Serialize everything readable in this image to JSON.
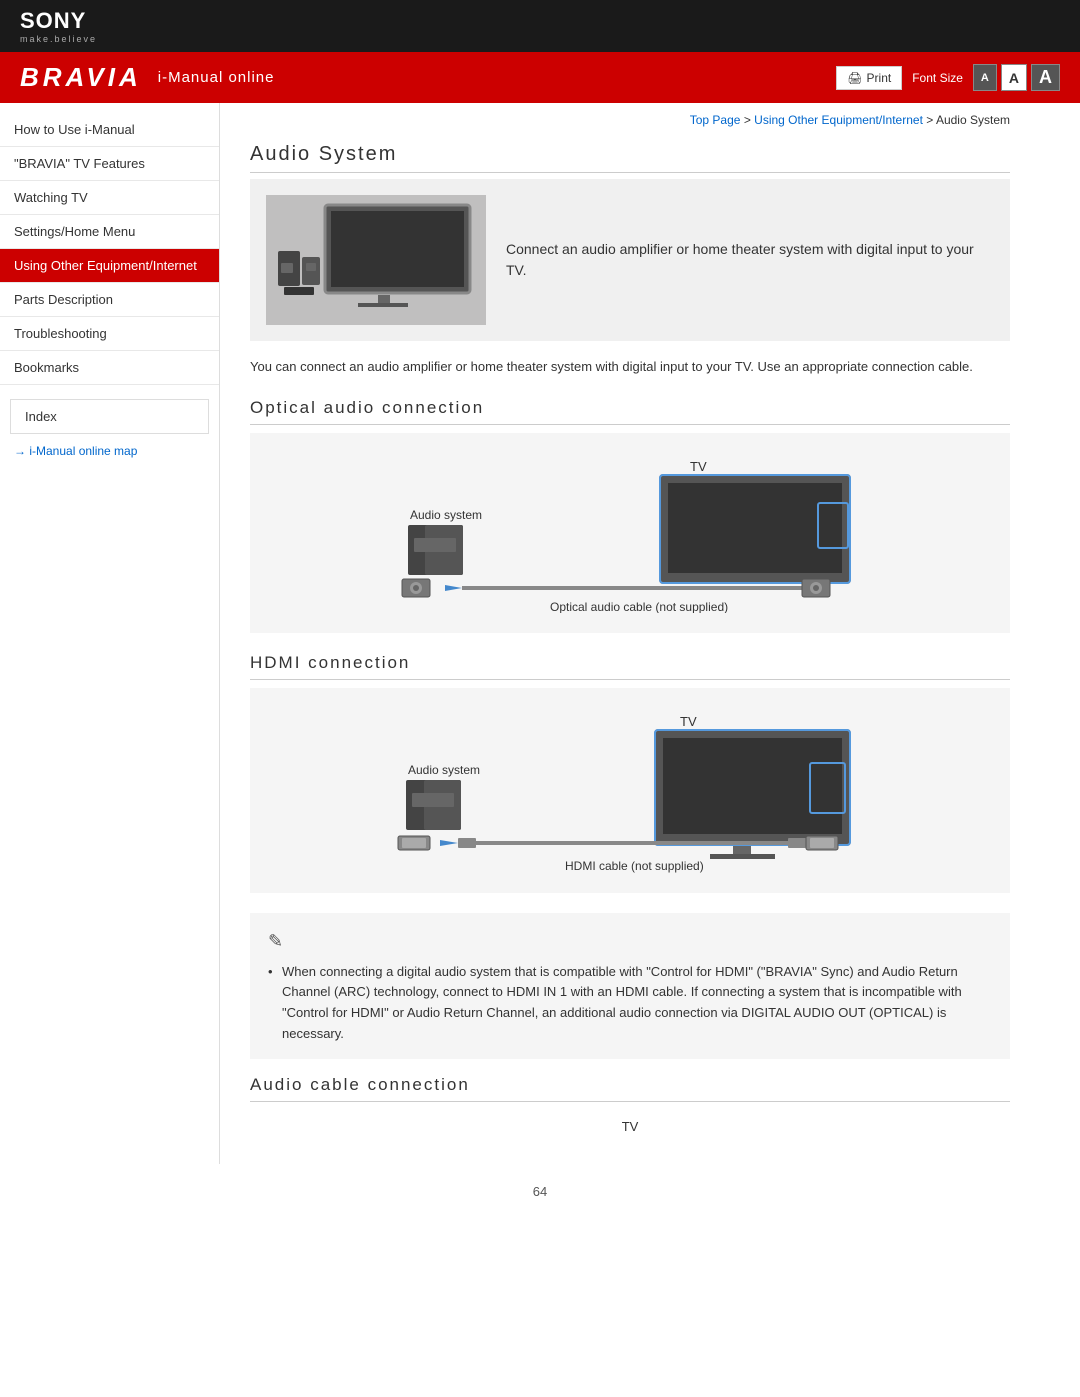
{
  "header": {
    "sony_logo": "SONY",
    "sony_tagline": "make.believe",
    "bravia_logo": "BRAVIA",
    "imanual_label": "i-Manual online",
    "print_label": "Print",
    "font_size_label": "Font Size",
    "font_sizes": [
      "A",
      "A",
      "A"
    ]
  },
  "breadcrumb": {
    "top_page": "Top Page",
    "separator1": " > ",
    "section": "Using Other Equipment/Internet",
    "separator2": " > ",
    "current": "Audio System"
  },
  "sidebar": {
    "items": [
      {
        "id": "how-to-use",
        "label": "How to Use i-Manual",
        "active": false
      },
      {
        "id": "bravia-features",
        "label": "\"BRAVIA\" TV Features",
        "active": false
      },
      {
        "id": "watching-tv",
        "label": "Watching TV",
        "active": false
      },
      {
        "id": "settings-home",
        "label": "Settings/Home Menu",
        "active": false
      },
      {
        "id": "using-other",
        "label": "Using Other Equipment/Internet",
        "active": true
      },
      {
        "id": "parts-description",
        "label": "Parts Description",
        "active": false
      },
      {
        "id": "troubleshooting",
        "label": "Troubleshooting",
        "active": false
      },
      {
        "id": "bookmarks",
        "label": "Bookmarks",
        "active": false
      }
    ],
    "index_label": "Index",
    "map_link": "→ i-Manual online map"
  },
  "content": {
    "page_title": "Audio System",
    "intro_text": "Connect an audio amplifier or home theater system with digital input to your TV.",
    "intro_desc": "You can connect an audio amplifier or home theater system with digital input to your TV. Use an appropriate connection cable.",
    "optical_title": "Optical audio connection",
    "optical_label_tv": "TV",
    "optical_label_audio": "Audio system",
    "optical_cable_label": "Optical audio cable (not supplied)",
    "hdmi_title": "HDMI connection",
    "hdmi_label_tv": "TV",
    "hdmi_label_audio": "Audio system",
    "hdmi_cable_label": "HDMI cable (not supplied)",
    "note_icon": "✎",
    "note_text": "When connecting a digital audio system that is compatible with \"Control for HDMI\" (\"BRAVIA\" Sync) and Audio Return Channel (ARC) technology, connect to HDMI IN 1 with an HDMI cable. If connecting a system that is incompatible with \"Control for HDMI\" or Audio Return Channel, an additional audio connection via DIGITAL AUDIO OUT (OPTICAL) is necessary.",
    "audio_cable_title": "Audio cable connection",
    "audio_cable_tv_label": "TV",
    "page_number": "64"
  }
}
